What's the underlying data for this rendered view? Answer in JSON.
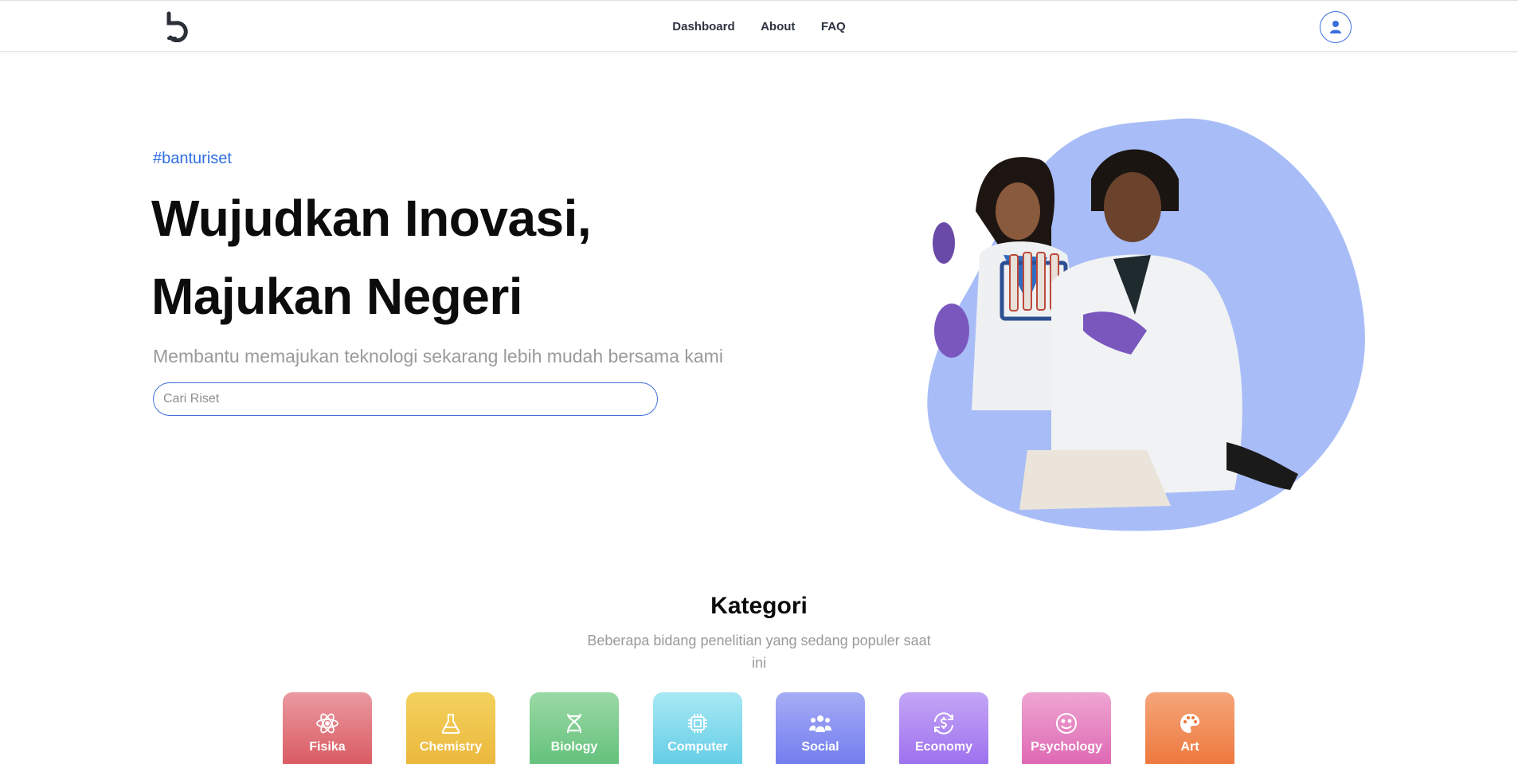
{
  "nav": {
    "links": [
      "Dashboard",
      "About",
      "FAQ"
    ]
  },
  "hero": {
    "hashtag": "#banturiset",
    "title": "Wujudkan Inovasi, Majukan Negeri",
    "subtitle": "Membantu memajukan teknologi sekarang lebih mudah bersama kami",
    "search_placeholder": "Cari Riset"
  },
  "category": {
    "title": "Kategori",
    "subtitle": "Beberapa bidang penelitian yang sedang populer saat ini",
    "items": [
      {
        "label": "Fisika",
        "icon": "atom-icon",
        "color_top": "#e99aa0",
        "color_bottom": "#d9545d"
      },
      {
        "label": "Chemistry",
        "icon": "flask-icon",
        "color_top": "#f3d25d",
        "color_bottom": "#ebb53a"
      },
      {
        "label": "Biology",
        "icon": "dna-icon",
        "color_top": "#9ad9a6",
        "color_bottom": "#5fbf77"
      },
      {
        "label": "Computer",
        "icon": "chip-icon",
        "color_top": "#a7e8f4",
        "color_bottom": "#5ecbe4"
      },
      {
        "label": "Social",
        "icon": "people-icon",
        "color_top": "#a6adf5",
        "color_bottom": "#6d78ee"
      },
      {
        "label": "Economy",
        "icon": "currency-exchange-icon",
        "color_top": "#c4a6f5",
        "color_bottom": "#9a6bee"
      },
      {
        "label": "Psychology",
        "icon": "smile-icon",
        "color_top": "#eea6d3",
        "color_bottom": "#dd62b0"
      },
      {
        "label": "Art",
        "icon": "palette-icon",
        "color_top": "#f5a67a",
        "color_bottom": "#ec7438"
      }
    ]
  },
  "colors": {
    "accent": "#2f6de1",
    "blob": "#a8bdf7"
  }
}
